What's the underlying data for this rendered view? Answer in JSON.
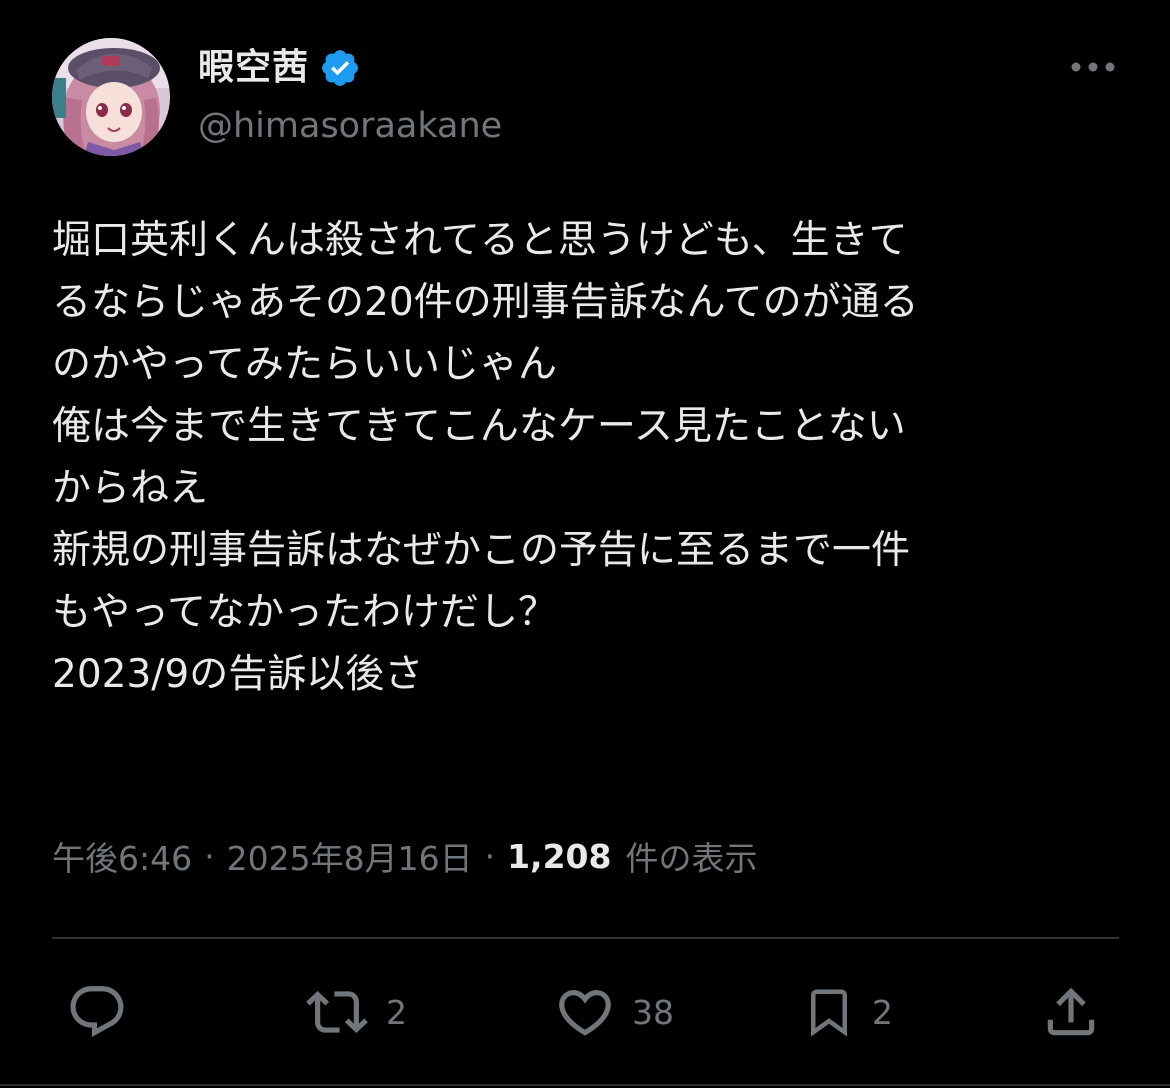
{
  "author": {
    "display_name": "暇空茜",
    "handle": "@himasoraakane",
    "verified_color": "#1d9bf0",
    "avatar_icon": "avatar-anime-girl"
  },
  "tweet": {
    "lines": [
      "堀口英利くんは殺されてると思うけども、生きて",
      "るならじゃあその20件の刑事告訴なんてのが通る",
      "のかやってみたらいいじゃん",
      "俺は今まで生きてきてこんなケース見たことない",
      "からねえ",
      "新規の刑事告訴はなぜかこの予告に至るまで一件",
      "もやってなかったわけだし？",
      "2023/9の告訴以後さ"
    ]
  },
  "meta": {
    "time": "午後6:46",
    "separator": "·",
    "date": "2025年8月16日",
    "views_count": "1,208",
    "views_label": "件の表示"
  },
  "actions": {
    "reply_icon": "reply-icon",
    "retweet_count": "2",
    "like_count": "38",
    "bookmark_count": "2",
    "share_icon": "share-icon"
  },
  "colors": {
    "background": "#000000",
    "text_primary": "#e7e9ea",
    "text_secondary": "#71767b",
    "divider": "#2f3336"
  }
}
